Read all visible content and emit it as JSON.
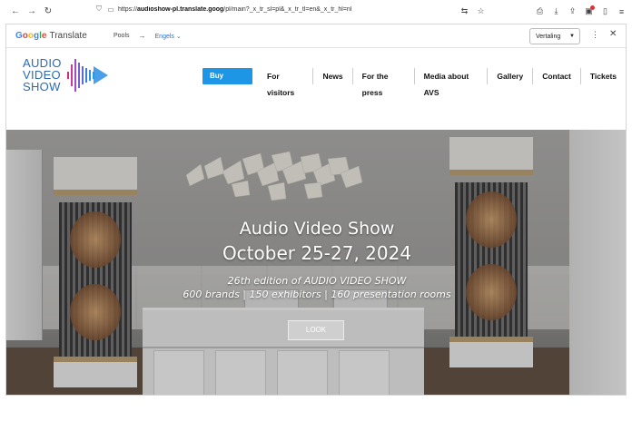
{
  "browser": {
    "url_prefix": "https://",
    "url_host": "audioshow-pl.translate.goog",
    "url_rest": "/pl/main?_x_tr_sl=pl&_x_tr_tl=en&_x_tr_hl=nl",
    "icons": [
      "back-icon",
      "forward-icon",
      "reload-icon",
      "shield-icon",
      "page-icon",
      "translate-icon",
      "star-icon",
      "print-icon",
      "download-icon",
      "share-icon",
      "extension-icon",
      "menu-icon"
    ]
  },
  "translate_bar": {
    "brand": "Google",
    "product": "Translate",
    "source_lang": "Pools",
    "target_lang": "Engels",
    "mode_select": "Vertaling"
  },
  "site": {
    "logo_lines": [
      "AUDIO",
      "VIDEO",
      "SHOW"
    ],
    "nav_cta": "Buy Tickets",
    "nav_items": [
      "For visitors",
      "News",
      "For the press",
      "Media about AVS",
      "Gallery",
      "Contact",
      "Tickets"
    ]
  },
  "hero": {
    "title": "Audio Video Show",
    "date": "October 25-27, 2024",
    "subtitle1": "26th edition of AUDIO VIDEO SHOW",
    "subtitle2": "600 brands | 150 exhibitors | 160 presentation rooms",
    "button": "LOOK"
  },
  "colors": {
    "accent": "#1e96e6",
    "logo": "#2a6bb8",
    "translate_link": "#1a73e8"
  }
}
